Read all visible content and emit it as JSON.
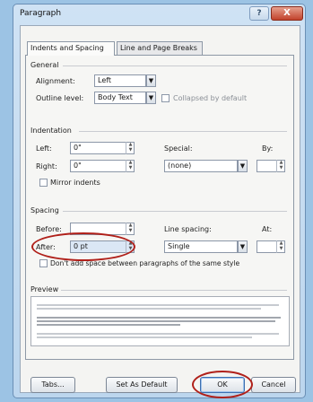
{
  "dialog": {
    "title": "Paragraph",
    "help_label": "?",
    "close_label": "X"
  },
  "tabs": [
    {
      "label": "Indents and Spacing"
    },
    {
      "label": "Line and Page Breaks"
    }
  ],
  "general": {
    "section_label": "General",
    "alignment_label": "Alignment:",
    "alignment_value": "Left",
    "outline_label": "Outline level:",
    "outline_value": "Body Text",
    "collapsed_label": "Collapsed by default"
  },
  "indentation": {
    "section_label": "Indentation",
    "left_label": "Left:",
    "left_value": "0\"",
    "right_label": "Right:",
    "right_value": "0\"",
    "special_label": "Special:",
    "special_value": "(none)",
    "by_label": "By:",
    "mirror_label": "Mirror indents"
  },
  "spacing": {
    "section_label": "Spacing",
    "before_label": "Before:",
    "after_label": "After:",
    "after_value": "0 pt",
    "line_spacing_label": "Line spacing:",
    "line_spacing_value": "Single",
    "at_label": "At:",
    "dont_add_label": "Don't add space between paragraphs of the same style"
  },
  "preview": {
    "section_label": "Preview"
  },
  "buttons": {
    "tabs": "Tabs...",
    "set_default": "Set As Default",
    "ok": "OK",
    "cancel": "Cancel"
  },
  "colors": {
    "annotation_circle": "#b0201a",
    "dialog_frame": "#bcd6ee"
  }
}
